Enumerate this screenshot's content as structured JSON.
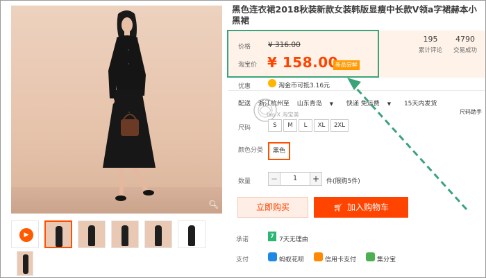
{
  "product": {
    "title": "黑色连衣裙2018秋装新款女装韩版显瘦中长款V领a字裙赫本小黑裙"
  },
  "price": {
    "price_label": "价格",
    "original_price": "¥ 316.00",
    "taobao_label": "淘宝价",
    "current_price": "¥ 158.00",
    "new_badge": "新品尝鲜"
  },
  "stats": [
    {
      "value": "195",
      "label": "累计评论"
    },
    {
      "value": "4790",
      "label": "交易成功"
    }
  ],
  "promo": {
    "label": "优惠",
    "coin_text": "淘金币可抵3.16元"
  },
  "shipping": {
    "prefix": "配送",
    "from": "浙江杭州至",
    "to": "山东青岛",
    "type": "快递 免运费",
    "delivery": "15天内发货"
  },
  "sales_label": "尺码助手",
  "watermark_text": "lao X 淘宝美",
  "size": {
    "label": "尺码",
    "options": [
      "S",
      "M",
      "L",
      "XL",
      "2XL"
    ]
  },
  "color": {
    "label": "颜色分类",
    "selected": "黑色"
  },
  "quantity": {
    "label": "数量",
    "minus": "−",
    "value": "1",
    "plus": "+",
    "unit": "件(限购5件)"
  },
  "actions": {
    "buy_now": "立即购买",
    "add_to_cart": "加入购物车"
  },
  "promise": {
    "label": "承诺",
    "icon_text": "7",
    "text": "7天无理由"
  },
  "payment": {
    "label": "支付",
    "methods": [
      {
        "name": "蚂蚁花呗",
        "icon": "huabei-icon",
        "color": "#1e88e5"
      },
      {
        "name": "信用卡支付",
        "icon": "credit-card-icon",
        "color": "#ff8a00"
      },
      {
        "name": "集分宝",
        "icon": "jifenbao-icon",
        "color": "#4caf50"
      }
    ]
  },
  "colors": {
    "accent": "#ff4400",
    "highlight_box": "#3aa37a",
    "price_bg": "#fff2e8"
  }
}
